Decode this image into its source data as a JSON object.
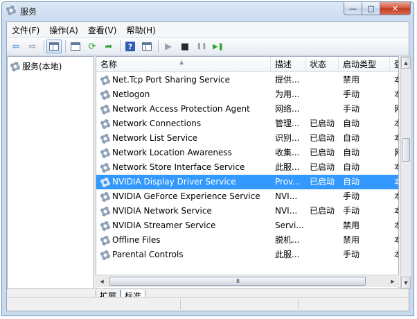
{
  "window": {
    "title": "服务",
    "controls": {
      "minimize": "—",
      "maximize": "□",
      "close": "✕"
    }
  },
  "menu": [
    "文件(F)",
    "操作(A)",
    "查看(V)",
    "帮助(H)"
  ],
  "toolbar": {
    "icons": [
      "back-icon",
      "forward-icon",
      "console-tree-icon",
      "properties-icon",
      "refresh-icon",
      "export-icon",
      "help-icon",
      "view-icon",
      "start-icon",
      "stop-icon",
      "pause-icon",
      "restart-icon"
    ],
    "glyphs": {
      "back": "⇦",
      "forward": "⇨",
      "refresh": "⟳",
      "export": "➦",
      "help": "?",
      "start": "▶",
      "stop": "■",
      "pause": "❚❚",
      "restart": "▶❚"
    }
  },
  "tree": {
    "root_label": "服务(本地)"
  },
  "table": {
    "columns": [
      "名称",
      "描述",
      "状态",
      "启动类型",
      "登"
    ],
    "rows": [
      {
        "name": "Net.Tcp Port Sharing Service",
        "desc": "提供...",
        "status": "",
        "startup": "禁用",
        "logon": "本"
      },
      {
        "name": "Netlogon",
        "desc": "为用...",
        "status": "",
        "startup": "手动",
        "logon": "本"
      },
      {
        "name": "Network Access Protection Agent",
        "desc": "网络...",
        "status": "",
        "startup": "手动",
        "logon": "网"
      },
      {
        "name": "Network Connections",
        "desc": "管理...",
        "status": "已启动",
        "startup": "自动",
        "logon": "本"
      },
      {
        "name": "Network List Service",
        "desc": "识别...",
        "status": "已启动",
        "startup": "自动",
        "logon": "本"
      },
      {
        "name": "Network Location Awareness",
        "desc": "收集...",
        "status": "已启动",
        "startup": "自动",
        "logon": "网"
      },
      {
        "name": "Network Store Interface Service",
        "desc": "此服...",
        "status": "已启动",
        "startup": "自动",
        "logon": "本"
      },
      {
        "name": "NVIDIA Display Driver Service",
        "desc": "Prov...",
        "status": "已启动",
        "startup": "自动",
        "logon": "本",
        "selected": true
      },
      {
        "name": "NVIDIA GeForce Experience Service",
        "desc": "NVI...",
        "status": "",
        "startup": "手动",
        "logon": "本"
      },
      {
        "name": "NVIDIA Network Service",
        "desc": "NVI...",
        "status": "已启动",
        "startup": "手动",
        "logon": "本"
      },
      {
        "name": "NVIDIA Streamer Service",
        "desc": "Servi...",
        "status": "",
        "startup": "禁用",
        "logon": "本"
      },
      {
        "name": "Offline Files",
        "desc": "脱机...",
        "status": "",
        "startup": "禁用",
        "logon": "本"
      },
      {
        "name": "Parental Controls",
        "desc": "此服...",
        "status": "",
        "startup": "手动",
        "logon": "本"
      }
    ]
  },
  "hscroll_grip": "III",
  "tabs": [
    "扩展",
    "标准"
  ],
  "colors": {
    "selection": "#3399ff",
    "title_gradient": "#c9dbef",
    "close_button": "#c43a1f"
  }
}
